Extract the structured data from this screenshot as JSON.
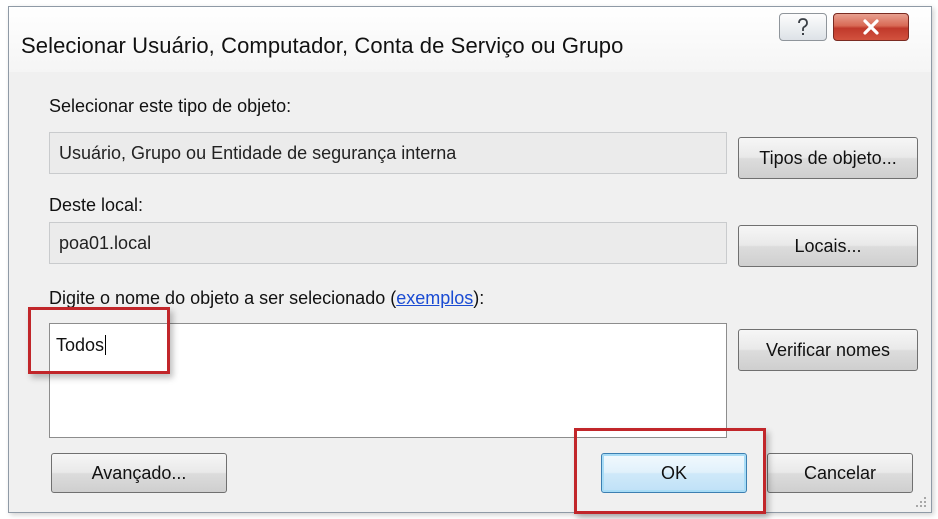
{
  "window": {
    "title": "Selecionar Usuário, Computador, Conta de Serviço ou Grupo",
    "help_symbol": "?",
    "close_symbol": "X"
  },
  "object_type": {
    "label": "Selecionar este tipo de objeto:",
    "value": "Usuário, Grupo ou Entidade de segurança interna",
    "button": "Tipos de objeto..."
  },
  "location": {
    "label": "Deste local:",
    "value": "poa01.local",
    "button": "Locais..."
  },
  "object_name": {
    "label_prefix": "Digite o nome do objeto a ser selecionado (",
    "link": "exemplos",
    "label_suffix": "):",
    "value": "Todos",
    "check_button": "Verificar nomes"
  },
  "footer": {
    "advanced_button": "Avançado...",
    "ok_button": "OK",
    "cancel_button": "Cancelar"
  },
  "colors": {
    "highlight": "#c1262a",
    "link": "#1a4bd3",
    "close_button": "#c0392b"
  }
}
